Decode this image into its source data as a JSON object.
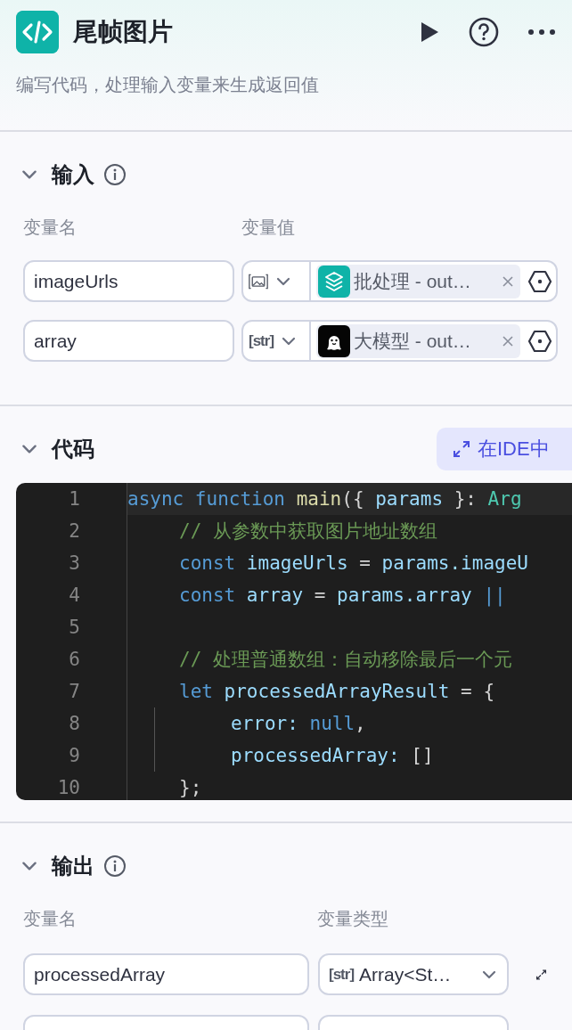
{
  "header": {
    "title": "尾帧图片",
    "description": "编写代码，处理输入变量来生成返回值"
  },
  "input_section": {
    "title": "输入",
    "expanded": true,
    "col_name": "变量名",
    "col_value": "变量值",
    "rows": [
      {
        "name": "imageUrls",
        "type": {
          "kind": "image"
        },
        "source": {
          "kind": "batch",
          "ref": "批处理 - out…"
        }
      },
      {
        "name": "array",
        "type": {
          "kind": "string",
          "label": "[str]"
        },
        "source": {
          "kind": "llm",
          "ref": "大模型 - out…"
        }
      }
    ]
  },
  "code_section": {
    "title": "代码",
    "expanded": true,
    "ide_button": "在IDE中",
    "lines": [
      {
        "number": "1",
        "tokens": [
          {
            "text": "async",
            "kind": "keyword"
          },
          {
            "text": " function",
            "kind": "keyword"
          },
          {
            "text": " main",
            "kind": "func"
          },
          {
            "text": "({ ",
            "kind": "punct"
          },
          {
            "text": "params",
            "kind": "var"
          },
          {
            "text": " }: ",
            "kind": "punct"
          },
          {
            "text": "Arg",
            "kind": "type"
          }
        ],
        "children": [
          {
            "number": "2",
            "tokens": [
              {
                "text": "// 从参数中获取图片地址数组",
                "kind": "comment"
              }
            ]
          },
          {
            "number": "3",
            "tokens": [
              {
                "text": "const",
                "kind": "keyword"
              },
              {
                "text": " imageUrls",
                "kind": "var"
              },
              {
                "text": " = ",
                "kind": "punct"
              },
              {
                "text": "params.imageU",
                "kind": "var"
              }
            ]
          },
          {
            "number": "4",
            "tokens": [
              {
                "text": "const",
                "kind": "keyword"
              },
              {
                "text": " array",
                "kind": "var"
              },
              {
                "text": " = ",
                "kind": "punct"
              },
              {
                "text": "params.array",
                "kind": "var"
              },
              {
                "text": " ||",
                "kind": "keyword"
              }
            ]
          },
          {
            "number": "5"
          },
          {
            "number": "6",
            "tokens": [
              {
                "text": "// 处理普通数组：自动移除最后一个元",
                "kind": "comment"
              }
            ]
          },
          {
            "number": "7",
            "tokens": [
              {
                "text": "let",
                "kind": "keyword"
              },
              {
                "text": " processedArrayResult",
                "kind": "var"
              },
              {
                "text": " = {",
                "kind": "punct"
              }
            ],
            "children": [
              {
                "number": "8",
                "tokens": [
                  {
                    "text": "error:",
                    "kind": "var"
                  },
                  {
                    "text": " null",
                    "kind": "keyword"
                  },
                  {
                    "text": ",",
                    "kind": "punct"
                  }
                ]
              },
              {
                "number": "9",
                "tokens": [
                  {
                    "text": "processedArray:",
                    "kind": "var"
                  },
                  {
                    "text": " []",
                    "kind": "punct"
                  }
                ]
              }
            ]
          },
          {
            "number": "10",
            "tokens": [
              {
                "text": "};",
                "kind": "punct"
              }
            ]
          }
        ]
      }
    ]
  },
  "output_section": {
    "title": "输出",
    "expanded": true,
    "col_name": "变量名",
    "col_type": "变量类型",
    "rows": [
      {
        "kind": "full",
        "name": "processedArray",
        "type_label": "[str]",
        "type": "Array<St…"
      },
      {
        "kind": "cut"
      }
    ]
  }
}
